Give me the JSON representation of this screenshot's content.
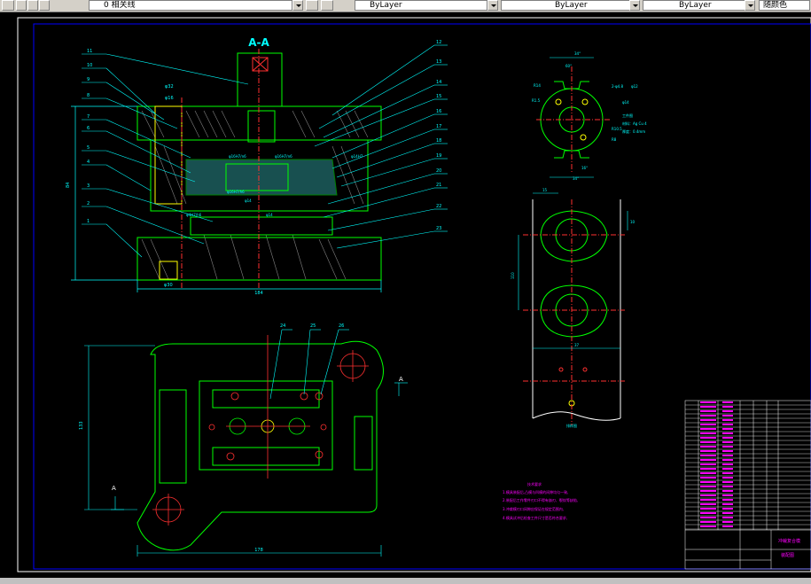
{
  "toolbar": {
    "layer_text": "0 相关线",
    "color_combo": "ByLayer",
    "linetype_combo": "ByLayer",
    "lineweight_combo": "ByLayer",
    "color_button": "随颜色"
  },
  "drawing": {
    "section_title": "A-A",
    "section_mark_left": "A",
    "section_mark_right": "A",
    "part_numbers_left": [
      "11",
      "10",
      "9",
      "8",
      "7",
      "6",
      "5",
      "4",
      "3",
      "2",
      "1"
    ],
    "part_numbers_right": [
      "12",
      "13",
      "14",
      "15",
      "16",
      "17",
      "18",
      "19",
      "20",
      "21",
      "22",
      "23"
    ],
    "top_numbers": [
      "24",
      "25",
      "26"
    ],
    "dimensions": {
      "height_left": "84",
      "width_bottom": "184",
      "phi_top": "φ32",
      "phi_small_top": "φ16",
      "phi_bottom": "φ30",
      "fit_1": "φ16H7/n6",
      "fit_2": "φ16H7/n6",
      "fit_3": "φ16H7/h6",
      "fit_4": "φ4H7/h6",
      "fit_5": "φ14",
      "fit_6": "φ14",
      "fit_7": "φ14H7",
      "plan_height": "133",
      "plan_width": "178",
      "strip_width": "37",
      "strip_top": "15",
      "strip_side": "10",
      "strip_pitch": "110",
      "part_angle_top": "34°",
      "part_angle_inner": "60°",
      "part_angle_bottom_inner": "16°",
      "part_angle_bottom": "34°",
      "part_r14": "R14",
      "part_r15": "R1.5",
      "part_r8": "R8",
      "part_r10": "R10.5",
      "part_phi": "φ14",
      "part_phi2": "2-φ4.8",
      "part_phi3": "φ12"
    },
    "part_notes": [
      "工件图",
      "材料：Ag Cu 4",
      "厚度：0.4mm"
    ],
    "strip_caption": "排样图",
    "tech_requirements_title": "技术要求",
    "tech_requirements": [
      "1.模具装配后,凸模与凹模的间隙均匀一致,",
      "2.装配后工作零件刃口不得有崩刃、裂纹等缺陷,",
      "3.冲裁模刃口间隙应保证在规定范围内,",
      "4.模具试冲后检查工件尺寸是否符合要求,"
    ],
    "title_block": {
      "title": "冲裁复合模",
      "drawing_name": "装配图"
    }
  }
}
